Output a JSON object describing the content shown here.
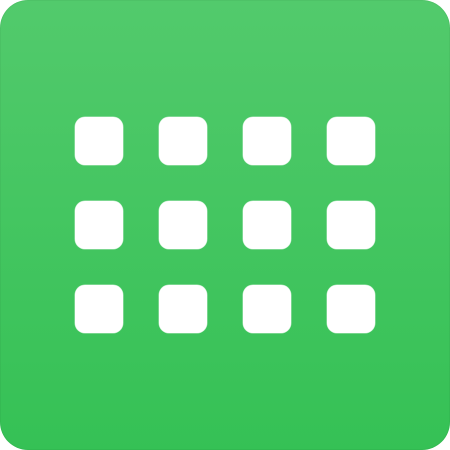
{
  "icon": {
    "semantic_name": "app-grid-icon",
    "colors": {
      "gradient_top": "#52CA6C",
      "gradient_bottom": "#35C155",
      "tile": "#FFFFFF"
    },
    "grid": {
      "rows": 3,
      "columns": 4
    }
  }
}
